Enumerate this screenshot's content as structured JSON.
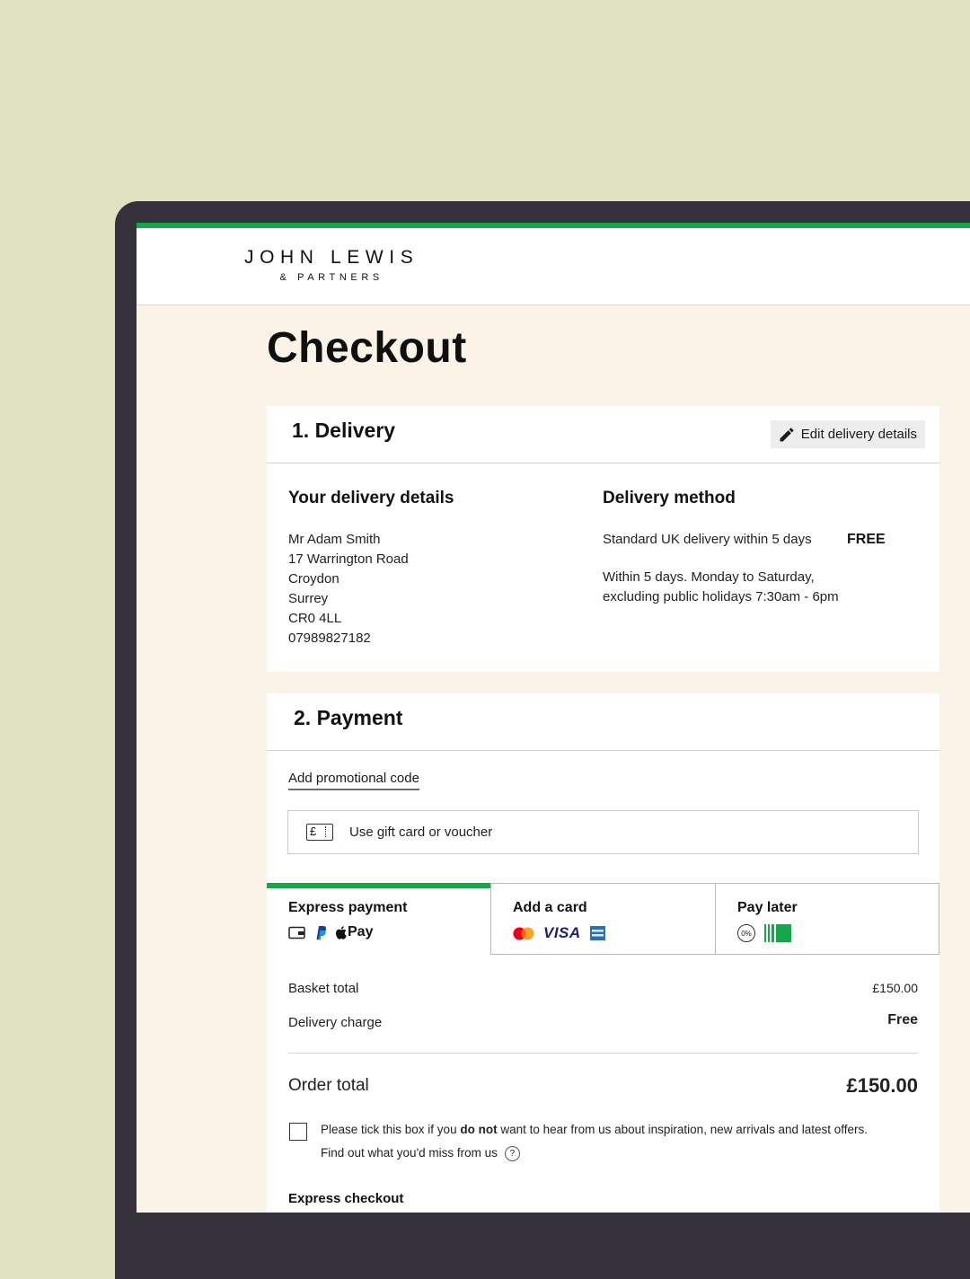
{
  "brand": {
    "name_line1": "JOHN LEWIS",
    "name_line2": "& PARTNERS",
    "accent_color": "#14a84b"
  },
  "page": {
    "title": "Checkout"
  },
  "delivery": {
    "section_title": "1. Delivery",
    "edit_button_label": "Edit delivery details",
    "edit_icon": "pencil-icon",
    "details_heading": "Your delivery details",
    "address_lines": [
      "Mr Adam Smith",
      "17 Warrington Road",
      "Croydon",
      "Surrey",
      "CR0 4LL",
      "07989827182"
    ],
    "method_heading": "Delivery method",
    "method_name": "Standard UK delivery within 5 days",
    "method_price": "FREE",
    "method_note_line1": "Within 5 days. Monday to Saturday,",
    "method_note_line2": "excluding public holidays 7:30am - 6pm"
  },
  "payment": {
    "section_title": "2. Payment",
    "promo_link": "Add promotional code",
    "gift_card_label": "Use gift card or voucher",
    "gift_card_icon_text": "£",
    "tabs": [
      {
        "label": "Express payment",
        "icons": [
          "wallet-icon",
          "paypal-icon",
          "apple-pay-icon"
        ],
        "apple_pay_text": "Pay"
      },
      {
        "label": "Add a card",
        "icons": [
          "mastercard-icon",
          "visa-icon",
          "amex-icon"
        ],
        "visa_text": "VISA"
      },
      {
        "label": "Pay later",
        "icons": [
          "zero-apr-icon",
          "installments-icon"
        ],
        "apr_text": "0%"
      }
    ],
    "active_tab": "Express payment"
  },
  "summary": {
    "basket_label": "Basket total",
    "basket_value": "£150.00",
    "delivery_label": "Delivery charge",
    "delivery_value": "Free",
    "order_label": "Order total",
    "order_value": "£150.00"
  },
  "marketing": {
    "consent_prefix": "Please tick this box if you ",
    "consent_bold": "do not",
    "consent_suffix": " want to hear from us about inspiration, new arrivals and latest offers.",
    "missing_link": "Find out what you'd miss from us",
    "help_symbol": "?"
  },
  "express_checkout": {
    "heading": "Express checkout"
  }
}
